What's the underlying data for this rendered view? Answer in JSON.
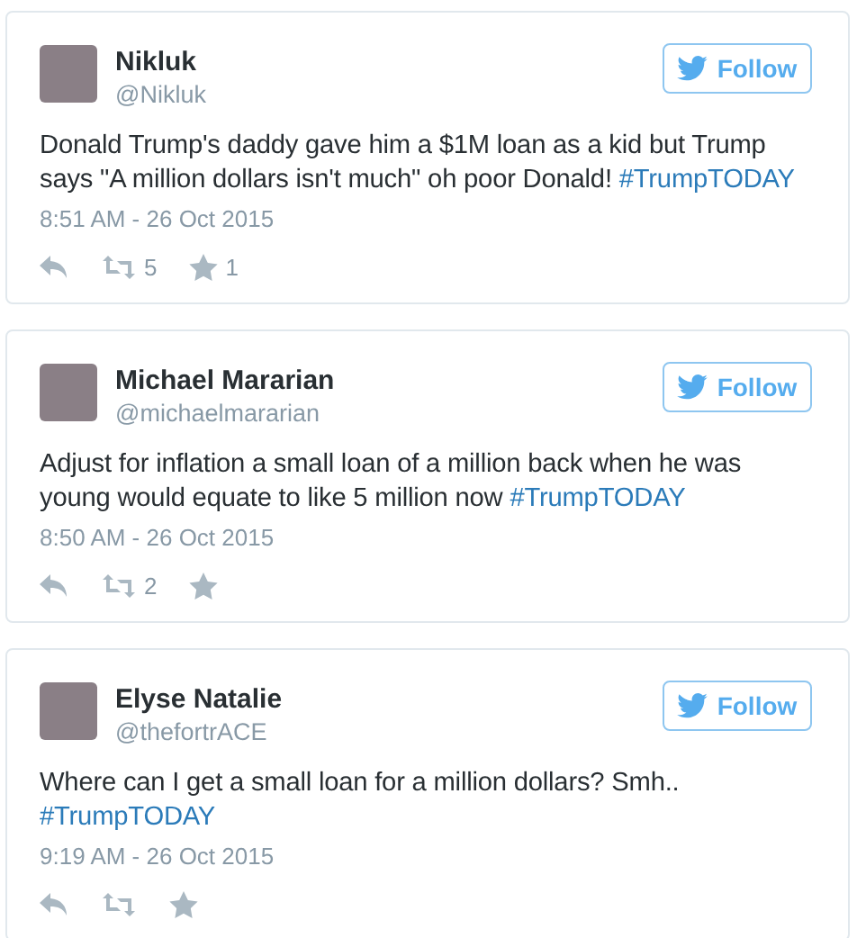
{
  "tweets": [
    {
      "name": "Nikluk",
      "handle": "@Nikluk",
      "follow": "Follow",
      "text": "Donald Trump's daddy gave him a $1M loan as a kid but Trump says \"A million dollars isn't much\" oh poor Donald! ",
      "hashtag": "#TrumpTODAY",
      "time": "8:51 AM - 26 Oct 2015",
      "retweets": "5",
      "likes": "1"
    },
    {
      "name": "Michael Mararian",
      "handle": "@michaelmararian",
      "follow": "Follow",
      "text": "Adjust for inflation a small loan of a million back when he was young would equate to like 5 million now  ",
      "hashtag": "#TrumpTODAY",
      "time": "8:50 AM - 26 Oct 2015",
      "retweets": "2"
    },
    {
      "name": "Elyse Natalie",
      "handle": "@thefortrACE",
      "follow": "Follow",
      "text": "Where can I get a small loan for a million dollars? Smh.. ",
      "hashtag": "#TrumpTODAY",
      "time": "9:19 AM - 26 Oct 2015"
    }
  ]
}
